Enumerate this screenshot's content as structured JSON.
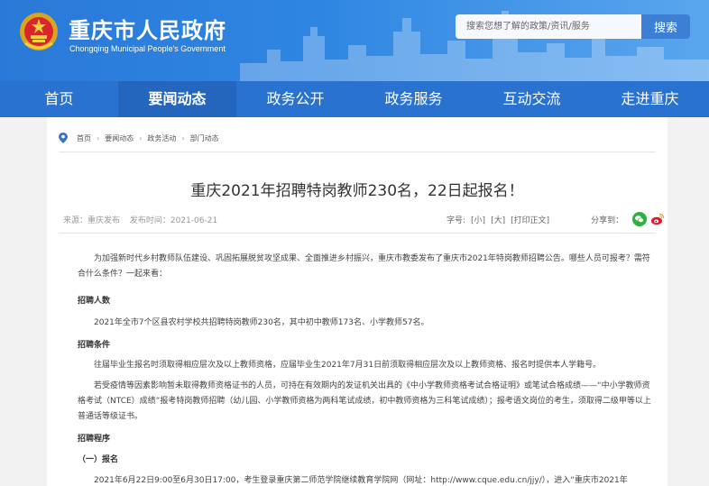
{
  "header": {
    "title": "重庆市人民政府",
    "subtitle": "Chongqing Municipal People's Government",
    "search_placeholder": "搜索您想了解的政策/资讯/服务",
    "search_button": "搜索"
  },
  "nav": {
    "items": [
      "首页",
      "要闻动态",
      "政务公开",
      "政务服务",
      "互动交流",
      "走进重庆"
    ],
    "active": "要闻动态"
  },
  "breadcrumb": [
    "首页",
    "要闻动态",
    "政务活动",
    "部门动态"
  ],
  "article": {
    "title": "重庆2021年招聘特岗教师230名，22日起报名！",
    "source": "来源：重庆发布",
    "date": "发布时间：2021-06-21",
    "font_label": "字号:",
    "font_small": "[小]",
    "font_large": "[大]",
    "print": "[打印正文]",
    "share_label": "分享到：",
    "p1": "为加强新时代乡村教师队伍建设、巩固拓展脱贫攻坚成果、全面推进乡村振兴，重庆市教委发布了重庆市2021年特岗教师招聘公告。哪些人员可报考？需符合什么条件？一起来看：",
    "h1": "招聘人数",
    "p2": "2021年全市7个区县农村学校共招聘特岗教师230名，其中初中教师173名、小学教师57名。",
    "h2": "招聘条件",
    "p3": "往届毕业生报名时须取得相应层次及以上教师资格，应届毕业生2021年7月31日前须取得相应层次及以上教师资格、报名时提供本人学籍号。",
    "p4": "若受疫情等因素影响暂未取得教师资格证书的人员，可持在有效期内的发证机关出具的《中小学教师资格考试合格证明》或笔试合格成绩——“中小学教师资格考试（NTCE）成绩”报考特岗教师招聘（幼儿园、小学教师资格为两科笔试成绩，初中教师资格为三科笔试成绩）；报考语文岗位的考生，须取得二级甲等以上普通话等级证书。",
    "h3": "招聘程序",
    "h4": "（一）报名",
    "p5": "2021年6月22日9:00至6月30日17:00，考生登录重庆第二师范学院继续教育学院网（网址：http://www.cque.edu.cn/jjy/），进入“重庆市2021年"
  },
  "colors": {
    "header_blue": "#2a79d8",
    "nav_blue": "#2a72cf",
    "wechat_green": "#2ab23a",
    "weibo_red": "#e6162d"
  }
}
